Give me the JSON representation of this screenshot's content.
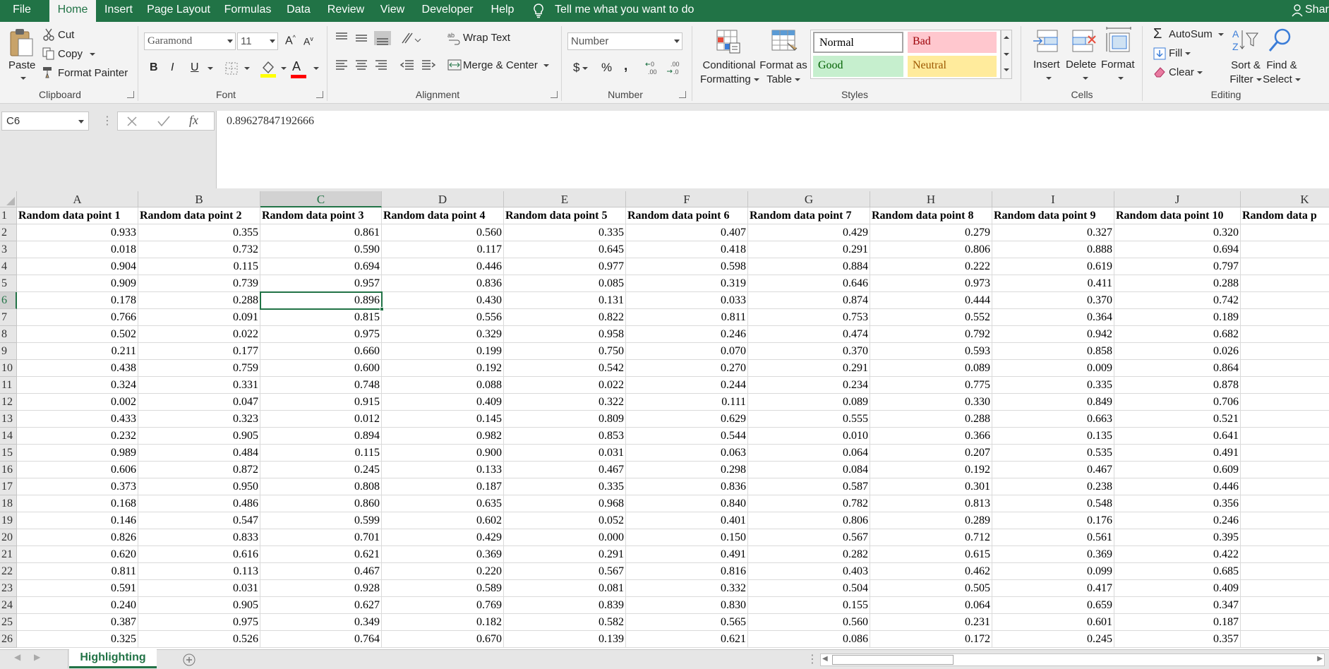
{
  "tabs": [
    "File",
    "Home",
    "Insert",
    "Page Layout",
    "Formulas",
    "Data",
    "Review",
    "View",
    "Developer",
    "Help"
  ],
  "active_tab": "Home",
  "tell_me": "Tell me what you want to do",
  "share": "Shar",
  "clipboard": {
    "paste": "Paste",
    "cut": "Cut",
    "copy": "Copy",
    "format_painter": "Format Painter",
    "label": "Clipboard"
  },
  "font": {
    "name": "Garamond",
    "size": "11",
    "label": "Font",
    "bold": "B",
    "italic": "I",
    "underline": "U",
    "grow": "A",
    "shrink": "A",
    "color_glyph": "A"
  },
  "alignment": {
    "wrap": "Wrap Text",
    "merge": "Merge & Center",
    "label": "Alignment"
  },
  "number": {
    "format": "Number",
    "label": "Number",
    "currency": "$",
    "percent": "%",
    "comma": ",",
    "inc_decimal": "←0 .00",
    "dec_decimal": ".00 →.0"
  },
  "styles": {
    "conditional": [
      "Conditional",
      "Formatting"
    ],
    "format_table": [
      "Format as",
      "Table"
    ],
    "normal": "Normal",
    "bad": "Bad",
    "good": "Good",
    "neutral": "Neutral",
    "label": "Styles"
  },
  "cells": {
    "insert": "Insert",
    "delete": "Delete",
    "format": "Format",
    "label": "Cells"
  },
  "editing": {
    "autosum": "AutoSum",
    "fill": "Fill",
    "clear": "Clear",
    "sort": [
      "Sort &",
      "Filter"
    ],
    "find": [
      "Find &",
      "Select"
    ],
    "label": "Editing"
  },
  "name_box": "C6",
  "formula": "0.89627847192666",
  "columns": [
    "A",
    "B",
    "C",
    "D",
    "E",
    "F",
    "G",
    "H",
    "I",
    "J",
    "K"
  ],
  "selected_col": "C",
  "selected_row": 6,
  "header_row": [
    "Random data point 1",
    "Random data point 2",
    "Random data point 3",
    "Random data point 4",
    "Random data point 5",
    "Random data point 6",
    "Random data point 7",
    "Random data point 8",
    "Random data point 9",
    "Random data point 10",
    "Random data p"
  ],
  "rows": [
    [
      "0.933",
      "0.355",
      "0.861",
      "0.560",
      "0.335",
      "0.407",
      "0.429",
      "0.279",
      "0.327",
      "0.320"
    ],
    [
      "0.018",
      "0.732",
      "0.590",
      "0.117",
      "0.645",
      "0.418",
      "0.291",
      "0.806",
      "0.888",
      "0.694"
    ],
    [
      "0.904",
      "0.115",
      "0.694",
      "0.446",
      "0.977",
      "0.598",
      "0.884",
      "0.222",
      "0.619",
      "0.797"
    ],
    [
      "0.909",
      "0.739",
      "0.957",
      "0.836",
      "0.085",
      "0.319",
      "0.646",
      "0.973",
      "0.411",
      "0.288"
    ],
    [
      "0.178",
      "0.288",
      "0.896",
      "0.430",
      "0.131",
      "0.033",
      "0.874",
      "0.444",
      "0.370",
      "0.742"
    ],
    [
      "0.766",
      "0.091",
      "0.815",
      "0.556",
      "0.822",
      "0.811",
      "0.753",
      "0.552",
      "0.364",
      "0.189"
    ],
    [
      "0.502",
      "0.022",
      "0.975",
      "0.329",
      "0.958",
      "0.246",
      "0.474",
      "0.792",
      "0.942",
      "0.682"
    ],
    [
      "0.211",
      "0.177",
      "0.660",
      "0.199",
      "0.750",
      "0.070",
      "0.370",
      "0.593",
      "0.858",
      "0.026"
    ],
    [
      "0.438",
      "0.759",
      "0.600",
      "0.192",
      "0.542",
      "0.270",
      "0.291",
      "0.089",
      "0.009",
      "0.864"
    ],
    [
      "0.324",
      "0.331",
      "0.748",
      "0.088",
      "0.022",
      "0.244",
      "0.234",
      "0.775",
      "0.335",
      "0.878"
    ],
    [
      "0.002",
      "0.047",
      "0.915",
      "0.409",
      "0.322",
      "0.111",
      "0.089",
      "0.330",
      "0.849",
      "0.706"
    ],
    [
      "0.433",
      "0.323",
      "0.012",
      "0.145",
      "0.809",
      "0.629",
      "0.555",
      "0.288",
      "0.663",
      "0.521"
    ],
    [
      "0.232",
      "0.905",
      "0.894",
      "0.982",
      "0.853",
      "0.544",
      "0.010",
      "0.366",
      "0.135",
      "0.641"
    ],
    [
      "0.989",
      "0.484",
      "0.115",
      "0.900",
      "0.031",
      "0.063",
      "0.064",
      "0.207",
      "0.535",
      "0.491"
    ],
    [
      "0.606",
      "0.872",
      "0.245",
      "0.133",
      "0.467",
      "0.298",
      "0.084",
      "0.192",
      "0.467",
      "0.609"
    ],
    [
      "0.373",
      "0.950",
      "0.808",
      "0.187",
      "0.335",
      "0.836",
      "0.587",
      "0.301",
      "0.238",
      "0.446"
    ],
    [
      "0.168",
      "0.486",
      "0.860",
      "0.635",
      "0.968",
      "0.840",
      "0.782",
      "0.813",
      "0.548",
      "0.356"
    ],
    [
      "0.146",
      "0.547",
      "0.599",
      "0.602",
      "0.052",
      "0.401",
      "0.806",
      "0.289",
      "0.176",
      "0.246"
    ],
    [
      "0.826",
      "0.833",
      "0.701",
      "0.429",
      "0.000",
      "0.150",
      "0.567",
      "0.712",
      "0.561",
      "0.395"
    ],
    [
      "0.620",
      "0.616",
      "0.621",
      "0.369",
      "0.291",
      "0.491",
      "0.282",
      "0.615",
      "0.369",
      "0.422"
    ],
    [
      "0.811",
      "0.113",
      "0.467",
      "0.220",
      "0.567",
      "0.816",
      "0.403",
      "0.462",
      "0.099",
      "0.685"
    ],
    [
      "0.591",
      "0.031",
      "0.928",
      "0.589",
      "0.081",
      "0.332",
      "0.504",
      "0.505",
      "0.417",
      "0.409"
    ],
    [
      "0.240",
      "0.905",
      "0.627",
      "0.769",
      "0.839",
      "0.830",
      "0.155",
      "0.064",
      "0.659",
      "0.347"
    ],
    [
      "0.387",
      "0.975",
      "0.349",
      "0.182",
      "0.582",
      "0.565",
      "0.560",
      "0.231",
      "0.601",
      "0.187"
    ],
    [
      "0.325",
      "0.526",
      "0.764",
      "0.670",
      "0.139",
      "0.621",
      "0.086",
      "0.172",
      "0.245",
      "0.357"
    ]
  ],
  "sheet_tab": "Highlighting",
  "colors": {
    "excel_green": "#217346",
    "bad_fill": "#ffc7ce",
    "bad_text": "#9c0006",
    "good_fill": "#c6efce",
    "good_text": "#006100",
    "neutral_fill": "#ffeb9c",
    "neutral_text": "#9c5700"
  }
}
